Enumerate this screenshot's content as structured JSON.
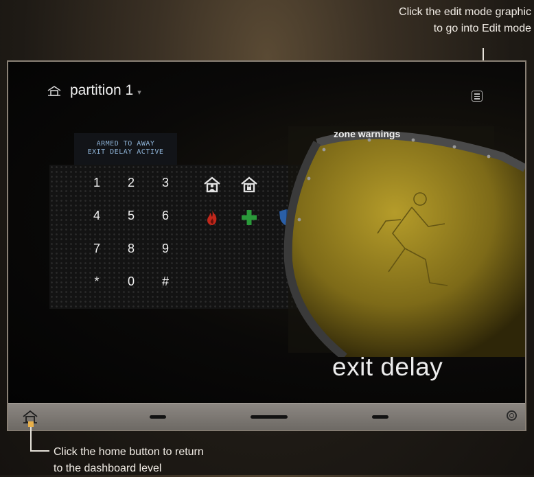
{
  "callouts": {
    "edit_line1": "Click the edit mode graphic",
    "edit_line2": "to go into Edit mode",
    "home_line1": "Click the home button to return",
    "home_line2": "to the dashboard level"
  },
  "header": {
    "title": "partition 1",
    "home_icon": "home-icon",
    "caret_icon": "chevron-down-icon",
    "edit_icon": "edit-mode-icon"
  },
  "status": {
    "line1": "ARMED TO AWAY",
    "line2": "EXIT DELAY ACTIVE"
  },
  "keypad": {
    "keys": [
      "1",
      "2",
      "3",
      "4",
      "5",
      "6",
      "7",
      "8",
      "9",
      "*",
      "0",
      "#"
    ]
  },
  "action_icons": [
    "arm-stay-icon",
    "arm-away-icon",
    "fire-icon",
    "medical-icon",
    "police-icon"
  ],
  "zone_warnings": {
    "label": "zone warnings",
    "state_label": "exit delay",
    "graphic": "running-man-shield-icon"
  },
  "bottom_bar": {
    "home_icon": "home-icon",
    "right_icon": "circle-icon"
  },
  "colors": {
    "background": "#050505",
    "callout_marker": "#e8b04a",
    "shield": "#8f7a1f",
    "lcd_text": "#8fb4d8",
    "fire": "#c1271b",
    "medical": "#2a9a3a",
    "police": "#2a5fa8",
    "bottom_bar": "#7d7873"
  }
}
